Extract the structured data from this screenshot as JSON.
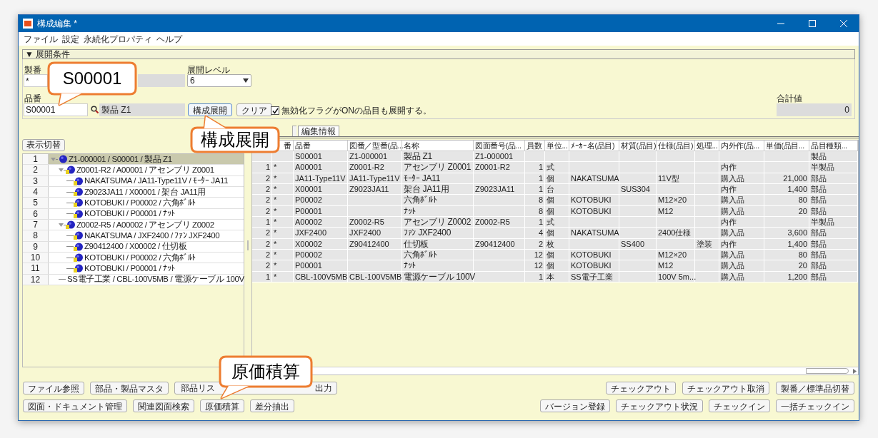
{
  "window": {
    "title": "構成編集 *"
  },
  "menu": [
    "ファイル",
    "設定",
    "永続化プロパティ",
    "ヘルプ"
  ],
  "conditions": {
    "header": "▼ 展開条件",
    "seiban": {
      "label": "製番",
      "value": "*"
    },
    "level": {
      "label": "展開レベル",
      "value": "6"
    },
    "hinban": {
      "label": "品番",
      "value": "S00001",
      "name": "製品 Z1"
    },
    "buttons": [
      "構成展開",
      "クリア"
    ],
    "checkbox": {
      "label": "無効化フラグがONの品目も展開する。",
      "checked": true
    },
    "total": {
      "label": "合計値",
      "value": "0"
    }
  },
  "toggle_button": "表示切替",
  "tree": [
    {
      "num": "1",
      "text": "Z1-000001 / S00001 / 製品 Z1",
      "selected": true,
      "expanded": true,
      "children": [
        {
          "num": "2",
          "text": "Z0001-R2 / A00001 / アセンブリ Z0001",
          "selected": false,
          "expanded": true,
          "children": [
            {
              "num": "3",
              "text": "NAKATSUMA / JA11-Type11V / ﾓｰﾀｰ JA11",
              "selected": false
            },
            {
              "num": "4",
              "text": "Z9023JA11 / X00001 / 架台 JA11用",
              "selected": false
            },
            {
              "num": "5",
              "text": "KOTOBUKI / P00002 / 六角ﾎﾞﾙﾄ",
              "selected": false
            },
            {
              "num": "6",
              "text": "KOTOBUKI / P00001 / ﾅｯﾄ",
              "selected": false
            }
          ]
        },
        {
          "num": "7",
          "text": "Z0002-R5 / A00002 / アセンブリ Z0002",
          "selected": false,
          "expanded": true,
          "children": [
            {
              "num": "8",
              "text": "NAKATSUMA / JXF2400 / ﾌｧﾝ JXF2400",
              "selected": false
            },
            {
              "num": "9",
              "text": "Z90412400 / X00002 / 仕切板",
              "selected": false
            },
            {
              "num": "10",
              "text": "KOTOBUKI / P00002 / 六角ﾎﾞﾙﾄ",
              "selected": false
            },
            {
              "num": "11",
              "text": "KOTOBUKI / P00001 / ﾅｯﾄ",
              "selected": false
            }
          ]
        },
        {
          "num": "12",
          "text": "SS電子工業 / CBL-100V5MB / 電源ケーブル 100V",
          "selected": false
        }
      ]
    }
  ],
  "tabs": [
    {
      "label": "編集情報",
      "selected": false
    }
  ],
  "table": {
    "columns": [
      null,
      "番",
      "品番",
      "図番／型番(品...",
      "名称",
      "図面番号(品...",
      "員数",
      "単位...",
      "ﾒｰｶｰ名(品目)",
      "材質(品目)",
      "仕様(品目)",
      "処理...",
      "内外作(品...",
      "単価(品目...",
      "品目種類..."
    ],
    "rows": [
      [
        null,
        null,
        "S00001",
        "Z1-000001",
        "製品 Z1",
        "Z1-000001",
        null,
        null,
        null,
        null,
        null,
        null,
        null,
        null,
        "製品"
      ],
      [
        "1",
        "*",
        "A00001",
        "Z0001-R2",
        "アセンブリ Z0001",
        "Z0001-R2",
        "1",
        "式",
        null,
        null,
        null,
        null,
        "内作",
        null,
        "半製品"
      ],
      [
        "2",
        "*",
        "JA11-Type11V",
        "JA11-Type11V",
        "ﾓｰﾀｰ JA11",
        null,
        "1",
        "個",
        "NAKATSUMA",
        null,
        "11V型",
        null,
        "購入品",
        "21,000",
        "部品"
      ],
      [
        "2",
        "*",
        "X00001",
        "Z9023JA11",
        "架台 JA11用",
        "Z9023JA11",
        "1",
        "台",
        null,
        "SUS304",
        null,
        null,
        "内作",
        "1,400",
        "部品"
      ],
      [
        "2",
        "*",
        "P00002",
        null,
        "六角ﾎﾞﾙﾄ",
        null,
        "8",
        "個",
        "KOTOBUKI",
        null,
        "M12×20",
        null,
        "購入品",
        "80",
        "部品"
      ],
      [
        "2",
        "*",
        "P00001",
        null,
        "ﾅｯﾄ",
        null,
        "8",
        "個",
        "KOTOBUKI",
        null,
        "M12",
        null,
        "購入品",
        "20",
        "部品"
      ],
      [
        "1",
        "*",
        "A00002",
        "Z0002-R5",
        "アセンブリ Z0002",
        "Z0002-R5",
        "1",
        "式",
        null,
        null,
        null,
        null,
        "内作",
        null,
        "半製品"
      ],
      [
        "2",
        "*",
        "JXF2400",
        "JXF2400",
        "ﾌｧﾝ JXF2400",
        null,
        "4",
        "個",
        "NAKATSUMA",
        null,
        "2400仕様",
        null,
        "購入品",
        "3,600",
        "部品"
      ],
      [
        "2",
        "*",
        "X00002",
        "Z90412400",
        "仕切板",
        "Z90412400",
        "2",
        "枚",
        null,
        "SS400",
        null,
        "塗装",
        "内作",
        "1,400",
        "部品"
      ],
      [
        "2",
        "*",
        "P00002",
        null,
        "六角ﾎﾞﾙﾄ",
        null,
        "12",
        "個",
        "KOTOBUKI",
        null,
        "M12×20",
        null,
        "購入品",
        "80",
        "部品"
      ],
      [
        "2",
        "*",
        "P00001",
        null,
        "ﾅｯﾄ",
        null,
        "12",
        "個",
        "KOTOBUKI",
        null,
        "M12",
        null,
        "購入品",
        "20",
        "部品"
      ],
      [
        "1",
        "*",
        "CBL-100V5MB",
        "CBL-100V5MB",
        "電源ケーブル 100V",
        null,
        "1",
        "本",
        "SS電子工業",
        null,
        "100V 5m...",
        null,
        "購入品",
        "1,200",
        "部品"
      ]
    ]
  },
  "buttons_top_left": [
    {
      "label": "ファイル参照"
    },
    {
      "label": "部品・製品マスタ"
    },
    {
      "label": "部品リス",
      "label_end": "出力"
    }
  ],
  "buttons_top_right": [
    {
      "label": "チェックアウト"
    },
    {
      "label": "チェックアウト取消"
    },
    {
      "label": "製番／標準品切替"
    }
  ],
  "buttons_bottom_left": [
    {
      "label": "図面・ドキュメント管理"
    },
    {
      "label": "関連図面検索"
    },
    {
      "label": "原価積算"
    },
    {
      "label": "差分抽出"
    }
  ],
  "buttons_bottom_right": [
    {
      "label": "バージョン登録"
    },
    {
      "label": "チェックアウト状況"
    },
    {
      "label": "チェックイン"
    },
    {
      "label": "一括チェックイン"
    }
  ],
  "callouts": [
    {
      "text": "S00001"
    },
    {
      "text": "構成展開"
    },
    {
      "text": "原価積算"
    }
  ]
}
